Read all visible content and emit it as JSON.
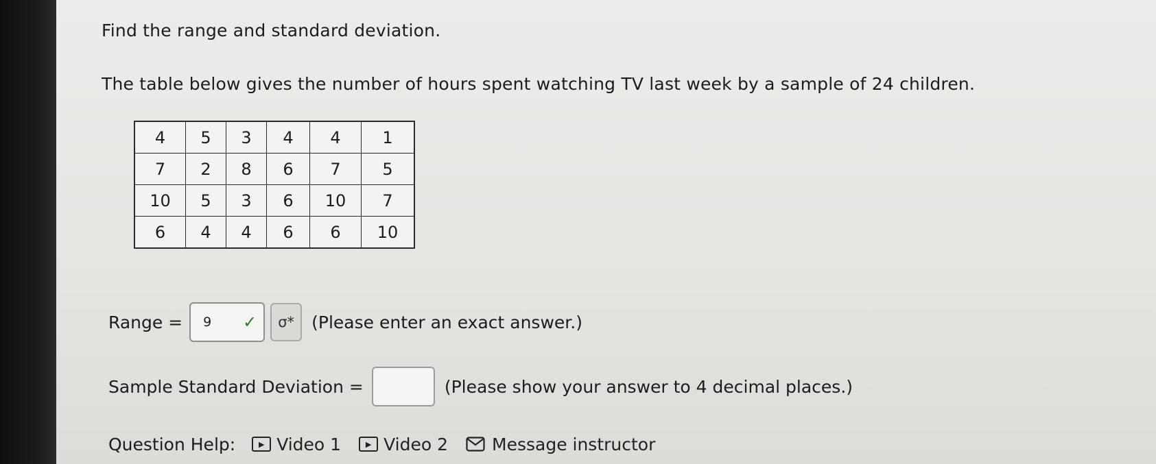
{
  "question": {
    "prompt": "Find the range and standard deviation.",
    "description": "The table below gives the number of hours spent watching TV last week by a sample of 24 children."
  },
  "table": {
    "rows": [
      [
        "4",
        "5",
        "3",
        "4",
        "4",
        "1"
      ],
      [
        "7",
        "2",
        "8",
        "6",
        "7",
        "5"
      ],
      [
        "10",
        "5",
        "3",
        "6",
        "10",
        "7"
      ],
      [
        "6",
        "4",
        "4",
        "6",
        "6",
        "10"
      ]
    ]
  },
  "range": {
    "label": "Range =",
    "value": "9",
    "status_icon": "check-icon",
    "preview_icon": "σ*",
    "hint": "(Please enter an exact answer.)"
  },
  "sd": {
    "label": "Sample Standard Deviation =",
    "value": "",
    "hint": "(Please show your answer to 4 decimal places.)"
  },
  "help": {
    "label": "Question Help:",
    "links": [
      "Video 1",
      "Video 2",
      "Message instructor"
    ]
  },
  "colors": {
    "correct": "#2f7a2f"
  }
}
